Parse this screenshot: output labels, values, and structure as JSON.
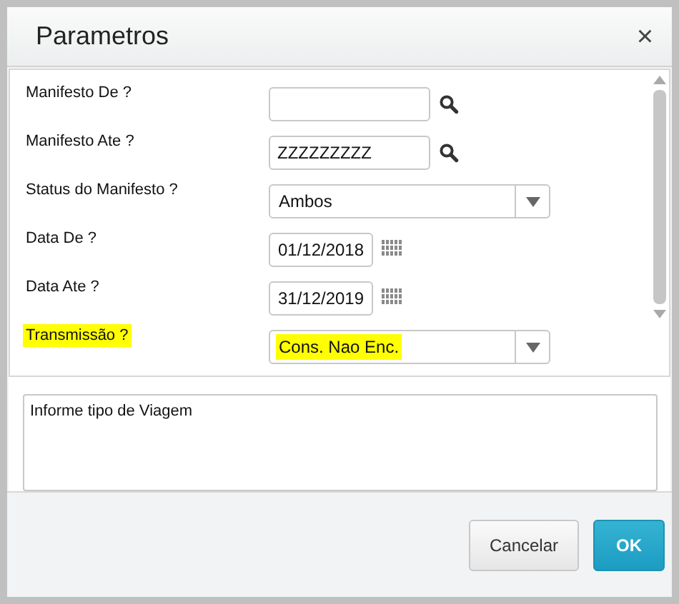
{
  "window": {
    "title": "Parametros",
    "close": "×"
  },
  "fields": [
    {
      "label": "Manifesto De ?",
      "kind": "lookup",
      "highlighted": false
    },
    {
      "label": "Manifesto Ate ?",
      "kind": "lookup",
      "value": "ZZZZZZZZZ",
      "highlighted": false
    },
    {
      "label": "Status do Manifesto ?",
      "kind": "select",
      "value": "Ambos",
      "highlighted": false
    },
    {
      "label": "Data De ?",
      "kind": "date",
      "value": "01/12/2018",
      "highlighted": false
    },
    {
      "label": "Data Ate ?",
      "kind": "date",
      "value": "31/12/2019",
      "highlighted": false
    },
    {
      "label": "Transmissão ?",
      "kind": "select",
      "value": "Cons. Nao Enc.",
      "highlighted": true
    }
  ],
  "help": "Informe tipo de Viagem",
  "buttons": [
    {
      "label": "Cancelar",
      "kind": "secondary"
    },
    {
      "label": "OK",
      "kind": "primary"
    }
  ]
}
